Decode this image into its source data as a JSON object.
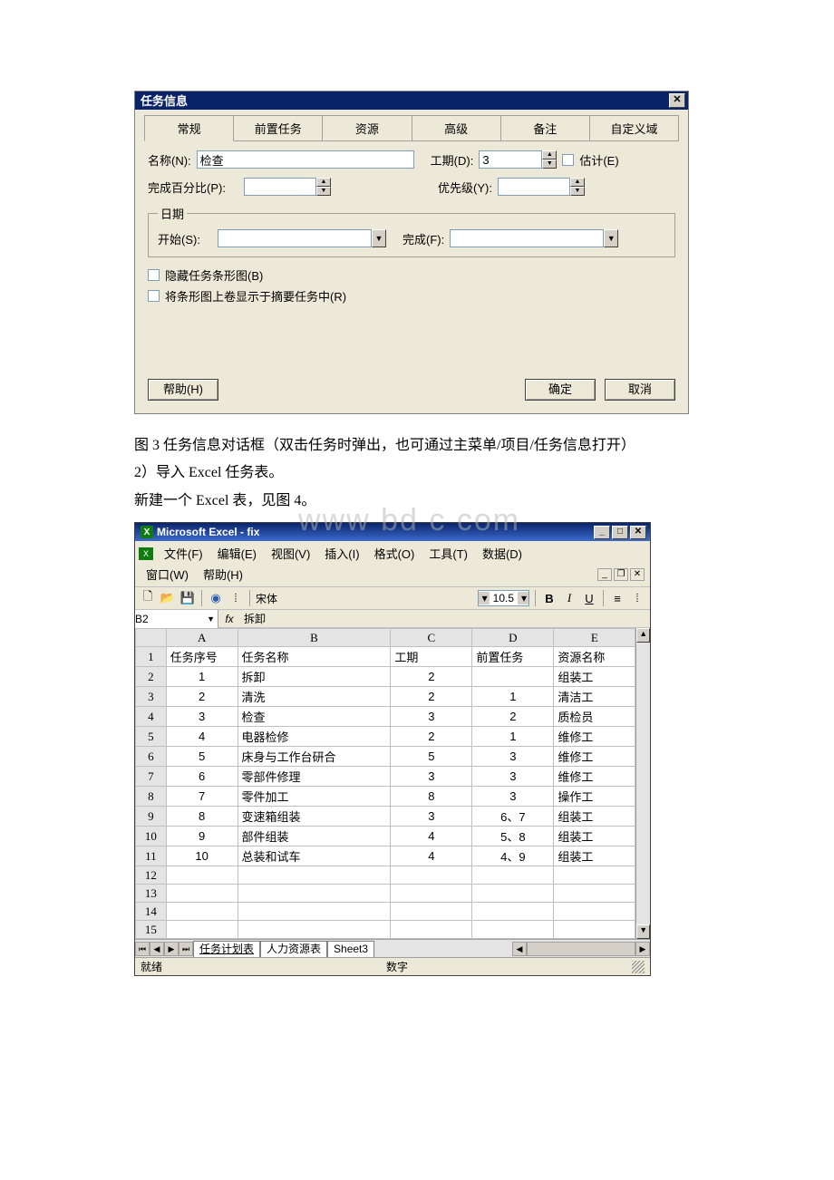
{
  "dialog": {
    "title": "任务信息",
    "tabs": [
      "常规",
      "前置任务",
      "资源",
      "高级",
      "备注",
      "自定义域"
    ],
    "active_tab": 0,
    "name_lbl": "名称(N):",
    "name_val": "检查",
    "duration_lbl": "工期(D):",
    "duration_val": "3",
    "estimate_lbl": "估计(E)",
    "percent_lbl": "完成百分比(P):",
    "percent_val": "",
    "priority_lbl": "优先级(Y):",
    "priority_val": "",
    "date_legend": "日期",
    "start_lbl": "开始(S):",
    "start_val": "",
    "finish_lbl": "完成(F):",
    "finish_val": "",
    "chk_hide": "隐藏任务条形图(B)",
    "chk_rollup": "将条形图上卷显示于摘要任务中(R)",
    "help_btn": "帮助(H)",
    "ok_btn": "确定",
    "cancel_btn": "取消"
  },
  "captions": {
    "line1": "图 3 任务信息对话框（双击任务时弹出，也可通过主菜单/项目/任务信息打开）",
    "line2": "2）导入 Excel 任务表。",
    "line3": "新建一个 Excel 表，见图 4。"
  },
  "watermark": "www bd c com",
  "excel": {
    "title": "Microsoft Excel - fix",
    "menus": [
      "文件(F)",
      "编辑(E)",
      "视图(V)",
      "插入(I)",
      "格式(O)",
      "工具(T)",
      "数据(D)",
      "窗口(W)",
      "帮助(H)"
    ],
    "font_name": "宋体",
    "font_size": "10.5",
    "namebox": "B2",
    "fx_label": "fx",
    "formula": "拆卸",
    "col_letters": [
      "A",
      "B",
      "C",
      "D",
      "E"
    ],
    "headers": [
      "任务序号",
      "任务名称",
      "工期",
      "前置任务",
      "资源名称"
    ],
    "rows": [
      {
        "n": "1",
        "seq": "1",
        "name": "拆卸",
        "dur": "2",
        "pre": "",
        "res": "组装工"
      },
      {
        "n": "2",
        "seq": "2",
        "name": "清洗",
        "dur": "2",
        "pre": "1",
        "res": "清洁工"
      },
      {
        "n": "3",
        "seq": "3",
        "name": "检查",
        "dur": "3",
        "pre": "2",
        "res": "质检员"
      },
      {
        "n": "4",
        "seq": "4",
        "name": "电器检修",
        "dur": "2",
        "pre": "1",
        "res": "维修工"
      },
      {
        "n": "5",
        "seq": "5",
        "name": "床身与工作台研合",
        "dur": "5",
        "pre": "3",
        "res": "维修工"
      },
      {
        "n": "6",
        "seq": "6",
        "name": "零部件修理",
        "dur": "3",
        "pre": "3",
        "res": "维修工"
      },
      {
        "n": "7",
        "seq": "7",
        "name": "零件加工",
        "dur": "8",
        "pre": "3",
        "res": "操作工"
      },
      {
        "n": "8",
        "seq": "8",
        "name": "变速箱组装",
        "dur": "3",
        "pre": "6、7",
        "res": "组装工"
      },
      {
        "n": "9",
        "seq": "9",
        "name": "部件组装",
        "dur": "4",
        "pre": "5、8",
        "res": "组装工"
      },
      {
        "n": "10",
        "seq": "10",
        "name": "总装和试车",
        "dur": "4",
        "pre": "4、9",
        "res": "组装工"
      }
    ],
    "empty_rows": [
      "12",
      "13",
      "14",
      "15"
    ],
    "sheets": [
      "任务计划表",
      "人力资源表",
      "Sheet3"
    ],
    "active_sheet": 0,
    "status_left": "就绪",
    "status_mid": "数字"
  }
}
